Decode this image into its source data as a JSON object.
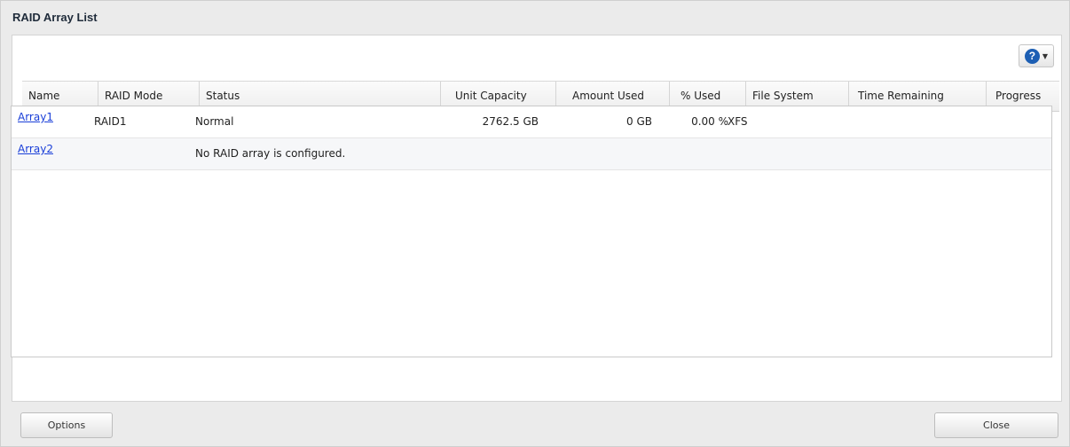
{
  "window": {
    "title": "RAID Array List"
  },
  "toolbar": {
    "help_icon": "?"
  },
  "table": {
    "columns": [
      "Name",
      "RAID Mode",
      "Status",
      "Unit Capacity",
      "Amount Used",
      "% Used",
      "File System",
      "Time Remaining",
      "Progress"
    ],
    "rows": [
      {
        "name": "Array1",
        "raid_mode": "RAID1",
        "status": "Normal",
        "unit_capacity": "2762.5 GB",
        "amount_used": "0 GB",
        "percent_used": "0.00 %",
        "file_system": "XFS",
        "time_remaining": "",
        "progress": ""
      },
      {
        "name": "Array2",
        "raid_mode": "",
        "status": "No RAID array is configured.",
        "unit_capacity": "",
        "amount_used": "",
        "percent_used": "",
        "file_system": "",
        "time_remaining": "",
        "progress": ""
      }
    ]
  },
  "footer": {
    "options_label": "Options",
    "close_label": "Close"
  },
  "colors": {
    "link": "#1a3fd8",
    "help_icon": "#1d5fb4"
  }
}
